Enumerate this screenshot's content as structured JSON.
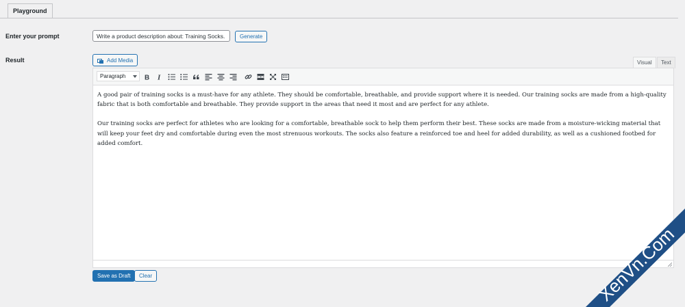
{
  "tabs": [
    {
      "label": "Playground"
    }
  ],
  "prompt": {
    "label": "Enter your prompt",
    "value": "Write a product description about: Training Socks.",
    "generate_label": "Generate"
  },
  "result": {
    "label": "Result",
    "add_media_label": "Add Media",
    "editor_tabs": {
      "visual": "Visual",
      "text": "Text"
    },
    "format_select": "Paragraph",
    "toolbar_icons": [
      "bold-icon",
      "italic-icon",
      "bullet-list-icon",
      "numbered-list-icon",
      "blockquote-icon",
      "align-left-icon",
      "align-center-icon",
      "align-right-icon",
      "link-icon",
      "read-more-icon",
      "fullscreen-icon",
      "toolbar-toggle-icon"
    ],
    "paragraphs": [
      "A good pair of training socks is a must-have for any athlete. They should be comfortable, breathable, and provide support where it is needed. Our training socks are made from a high-quality fabric that is both comfortable and breathable. They provide support in the areas that need it most and are perfect for any athlete.",
      "Our training socks are perfect for athletes who are looking for a comfortable, breathable sock to help them perform their best. These socks are made from a moisture-wicking material that will keep your feet dry and comfortable during even the most strenuous workouts. The socks also feature a reinforced toe and heel for added durability, as well as a cushioned footbed for added comfort."
    ]
  },
  "actions": {
    "save_draft_label": "Save as Draft",
    "clear_label": "Clear"
  },
  "watermark": {
    "text": "XenVn.Com"
  },
  "colors": {
    "primary": "#2271b1",
    "background": "#f0f0f1",
    "watermark": "#1f4f86"
  }
}
